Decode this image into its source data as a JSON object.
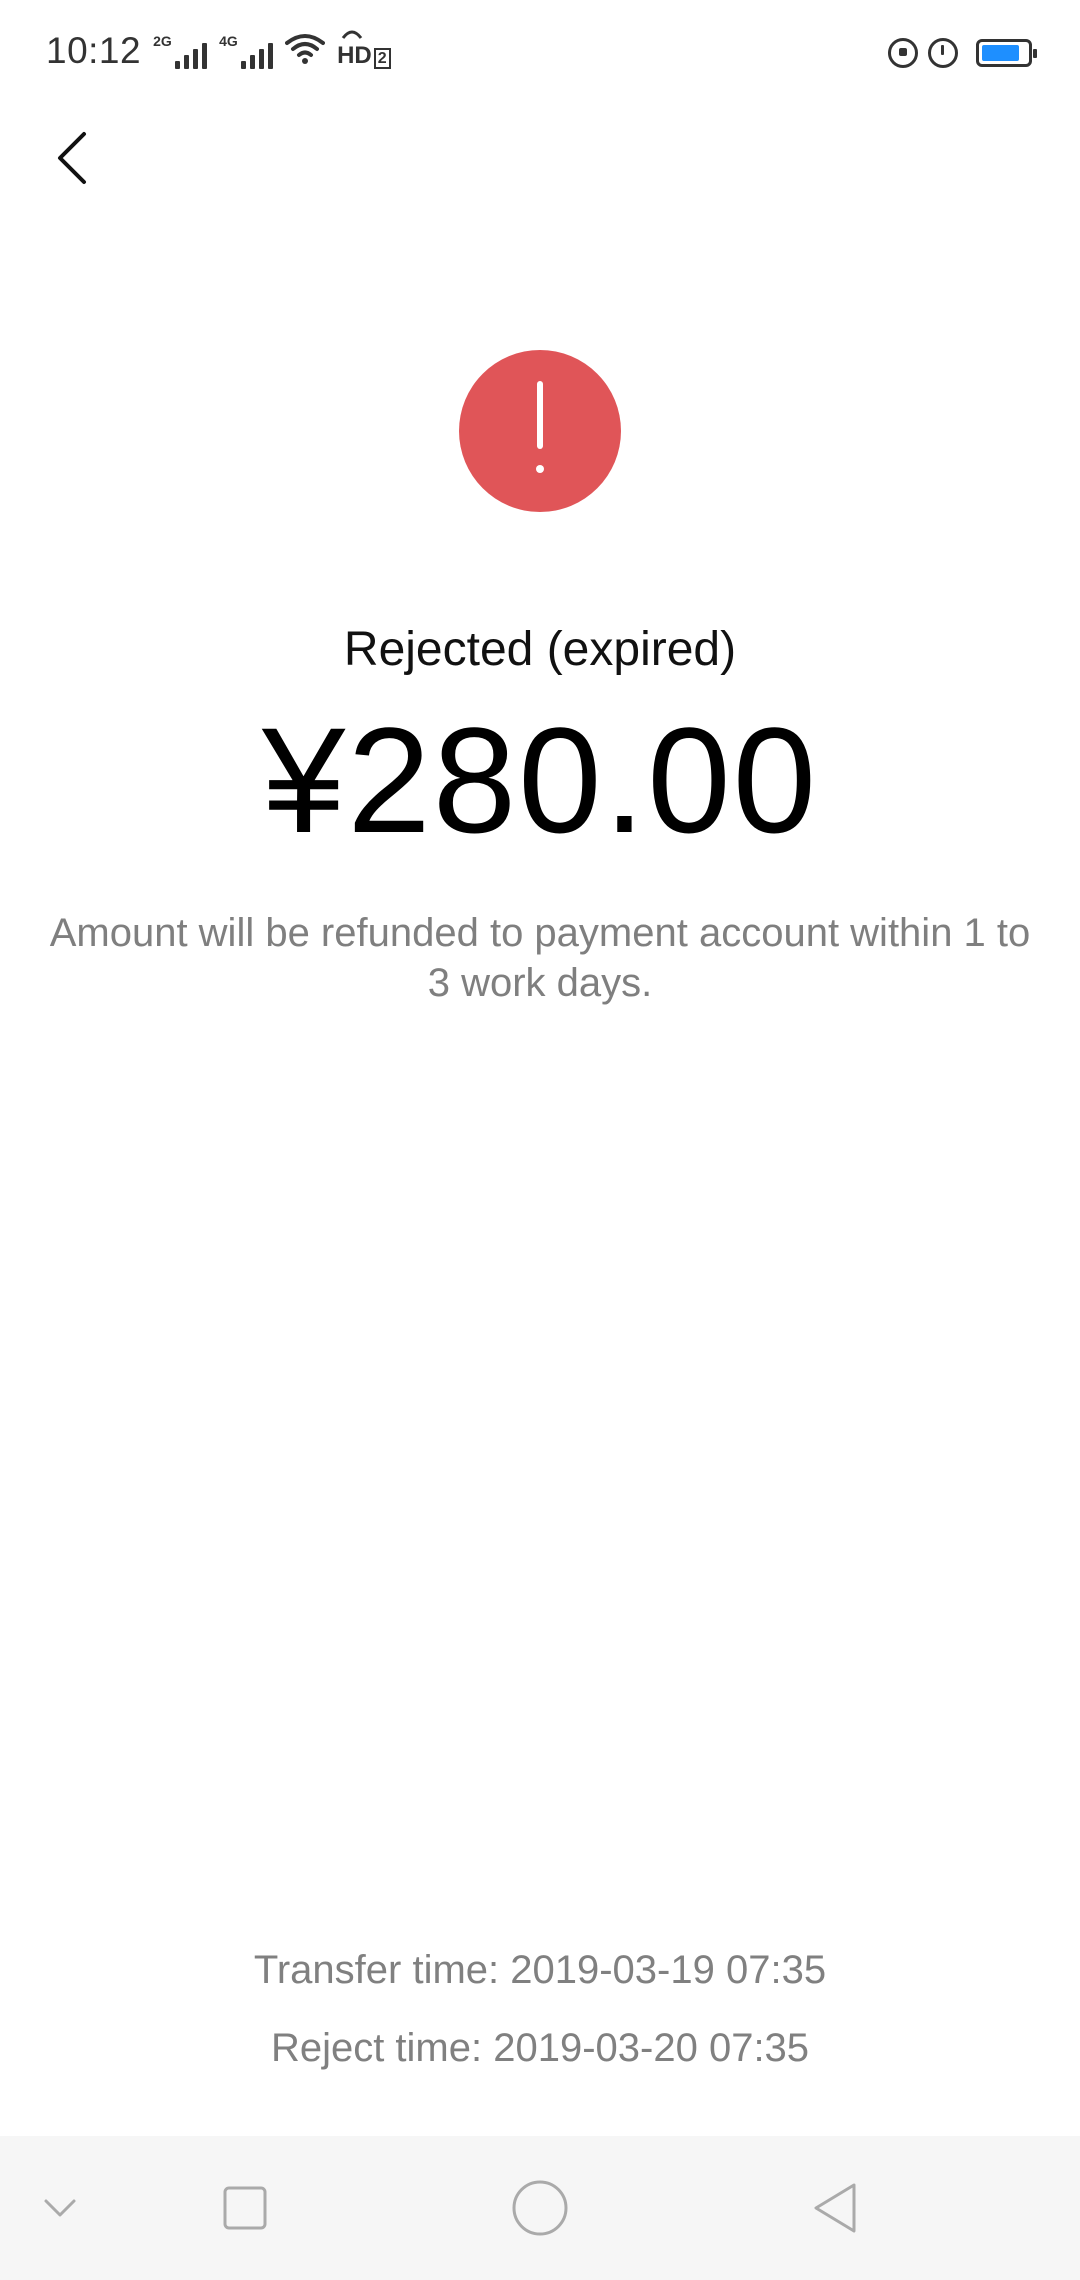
{
  "status_bar": {
    "time": "10:12",
    "signal_1_label": "2G",
    "signal_2_label": "4G",
    "hd_label": "HD",
    "hd_sub": "2",
    "battery_level": 0.85,
    "icons": [
      "wifi-icon",
      "hd-voice-icon",
      "rotation-lock-icon",
      "alarm-icon",
      "battery-icon"
    ]
  },
  "header": {
    "back_icon": "chevron-left-icon"
  },
  "result": {
    "icon": "exclamation-icon",
    "icon_color": "#e05558",
    "title": "Rejected (expired)",
    "amount": "¥280.00",
    "note": "Amount will be refunded to payment account within 1 to 3 work days."
  },
  "details": {
    "transfer_time": "Transfer time: 2019-03-19 07:35",
    "reject_time": "Reject time: 2019-03-20 07:35"
  },
  "nav_bar": {
    "icons": [
      "chevron-down-icon",
      "recents-square-icon",
      "home-circle-icon",
      "back-triangle-icon"
    ]
  }
}
